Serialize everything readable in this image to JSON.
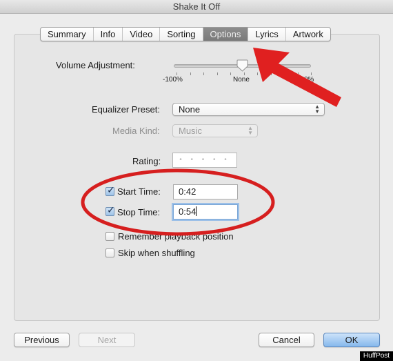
{
  "window": {
    "title": "Shake It Off"
  },
  "tabs": [
    {
      "label": "Summary",
      "active": false
    },
    {
      "label": "Info",
      "active": false
    },
    {
      "label": "Video",
      "active": false
    },
    {
      "label": "Sorting",
      "active": false
    },
    {
      "label": "Options",
      "active": true
    },
    {
      "label": "Lyrics",
      "active": false
    },
    {
      "label": "Artwork",
      "active": false
    }
  ],
  "options": {
    "volume": {
      "label": "Volume Adjustment:",
      "min_label": "-100%",
      "mid_label": "None",
      "max_label": "+100%",
      "value_percent": 0
    },
    "equalizer": {
      "label": "Equalizer Preset:",
      "value": "None"
    },
    "media_kind": {
      "label": "Media Kind:",
      "value": "Music",
      "disabled": true
    },
    "rating": {
      "label": "Rating:",
      "stars_placeholder": "• • • • •",
      "value": 0
    },
    "start_time": {
      "label": "Start Time:",
      "checked": true,
      "value": "0:42"
    },
    "stop_time": {
      "label": "Stop Time:",
      "checked": true,
      "value": "0:54"
    },
    "remember_position": {
      "label": "Remember playback position",
      "checked": false
    },
    "skip_shuffling": {
      "label": "Skip when shuffling",
      "checked": false
    }
  },
  "buttons": {
    "previous": "Previous",
    "next": "Next",
    "cancel": "Cancel",
    "ok": "OK"
  },
  "annotations": {
    "arrow_color": "#e02020",
    "ellipse_color": "#d61f1f"
  },
  "watermark": "HuffPost"
}
